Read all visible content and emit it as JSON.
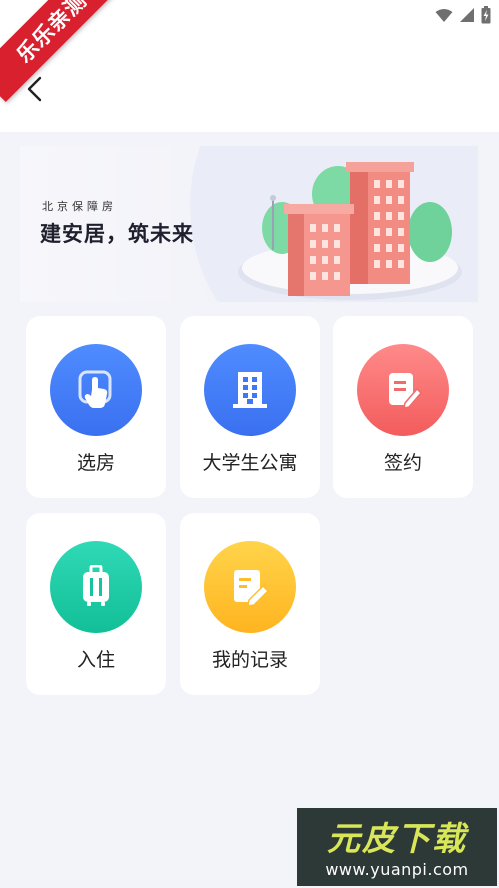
{
  "ribbon": {
    "text": "乐乐亲测"
  },
  "status_bar": {
    "icons": [
      "wifi-icon",
      "signal-icon",
      "battery-icon"
    ]
  },
  "nav": {
    "back_icon": "back-arrow-icon"
  },
  "banner": {
    "subtitle": "北京保障房",
    "title": "建安居，筑未来"
  },
  "menu": [
    {
      "label": "选房",
      "icon": "touch-select-icon",
      "color": "#4a85fb"
    },
    {
      "label": "大学生公寓",
      "icon": "building-icon",
      "color": "#4a85fb"
    },
    {
      "label": "签约",
      "icon": "sign-document-icon",
      "color": "#f86f6f"
    },
    {
      "label": "入住",
      "icon": "luggage-icon",
      "color": "#1fcca6"
    },
    {
      "label": "我的记录",
      "icon": "record-edit-icon",
      "color": "#ffc233"
    }
  ],
  "watermark": {
    "title": "元皮下载",
    "url": "www.yuanpi.com"
  }
}
